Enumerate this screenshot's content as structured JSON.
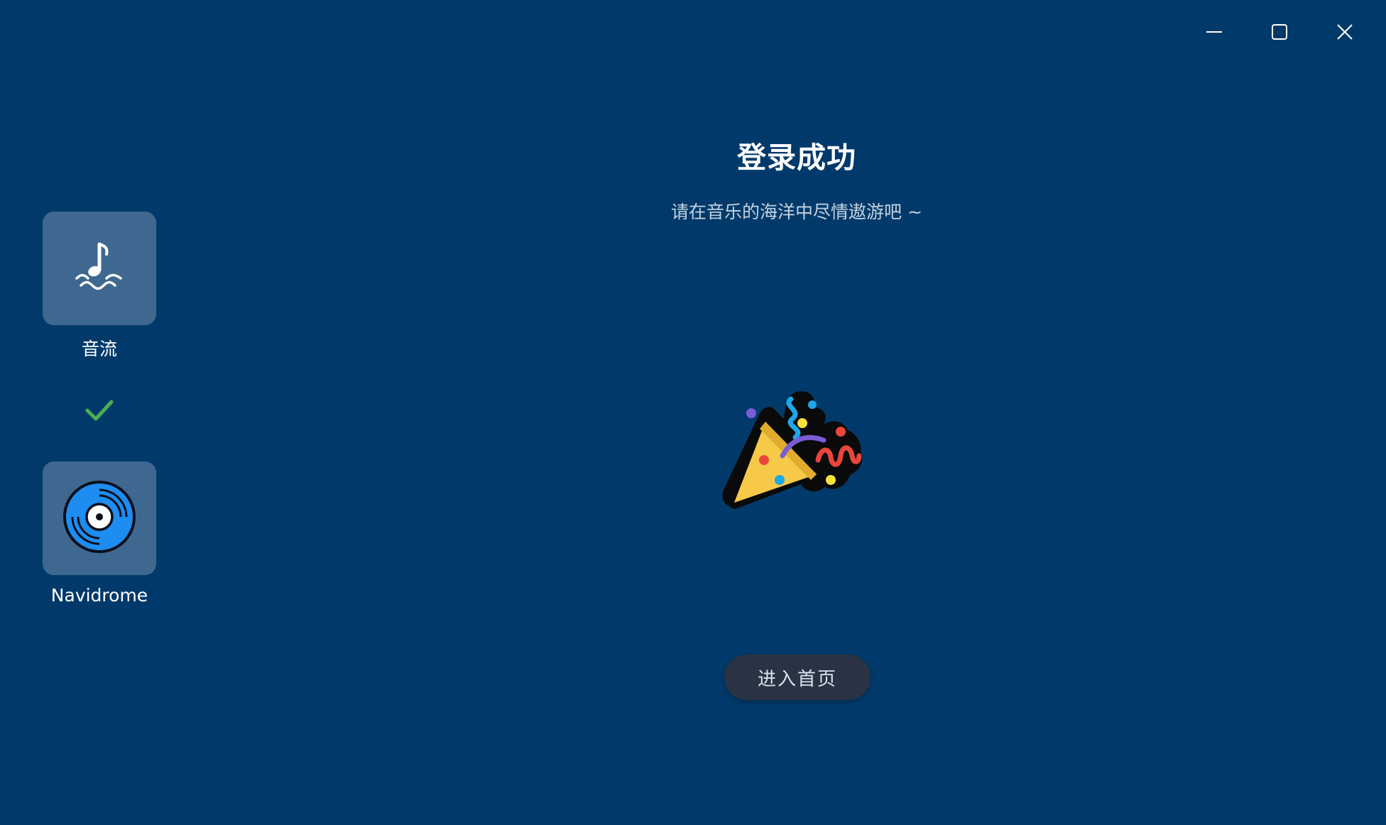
{
  "window": {
    "controls": {
      "minimize_icon": "minimize-icon",
      "maximize_icon": "maximize-icon",
      "close_icon": "close-icon"
    }
  },
  "stepper": {
    "source_app": {
      "label": "音流",
      "icon": "music-note-wave-icon"
    },
    "status_icon": "checkmark-icon",
    "status_color": "#4caf50",
    "target_app": {
      "label": "Navidrome",
      "icon": "vinyl-disc-icon"
    }
  },
  "main": {
    "title": "登录成功",
    "subtitle": "请在音乐的海洋中尽情遨游吧 ~",
    "illustration_icon": "party-popper-icon",
    "enter_button_label": "进入首页"
  },
  "colors": {
    "background": "#013a6a",
    "tile": "#3f6890",
    "button": "#2a3343"
  }
}
